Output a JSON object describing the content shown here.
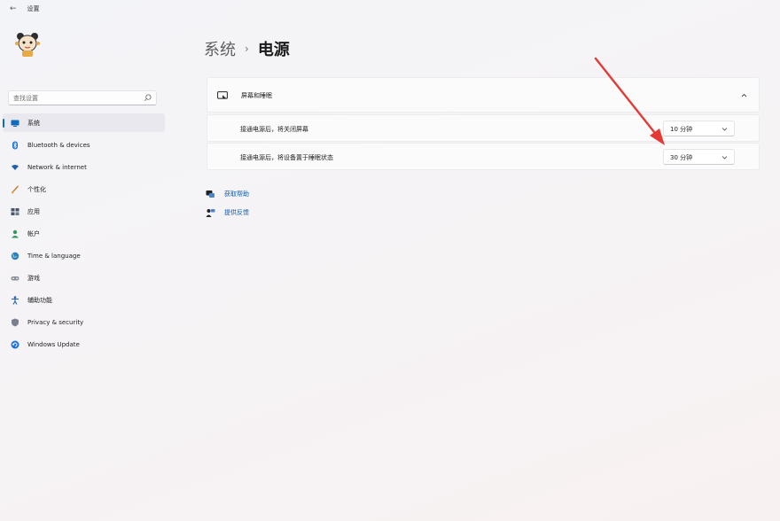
{
  "window": {
    "title": "设置"
  },
  "search": {
    "placeholder": "查找设置"
  },
  "sidebar": {
    "items": [
      {
        "label": "系统",
        "icon": "monitor-icon",
        "active": true
      },
      {
        "label": "Bluetooth & devices",
        "icon": "bluetooth-icon"
      },
      {
        "label": "Network & internet",
        "icon": "wifi-icon"
      },
      {
        "label": "个性化",
        "icon": "brush-icon"
      },
      {
        "label": "应用",
        "icon": "apps-icon"
      },
      {
        "label": "帐户",
        "icon": "person-icon"
      },
      {
        "label": "Time & language",
        "icon": "globe-clock-icon"
      },
      {
        "label": "游戏",
        "icon": "gamepad-icon"
      },
      {
        "label": "辅助功能",
        "icon": "accessibility-icon"
      },
      {
        "label": "Privacy & security",
        "icon": "shield-icon"
      },
      {
        "label": "Windows Update",
        "icon": "update-icon"
      }
    ]
  },
  "header": {
    "parent": "系统",
    "separator": "›",
    "current": "电源"
  },
  "section": {
    "title": "屏幕和睡眠",
    "rows": [
      {
        "label": "接通电源后，将关闭屏幕",
        "value": "10 分钟"
      },
      {
        "label": "接通电源后，将设备置于睡眠状态",
        "value": "30 分钟"
      }
    ]
  },
  "links": [
    {
      "label": "获取帮助",
      "icon": "help-icon"
    },
    {
      "label": "提供反馈",
      "icon": "feedback-icon"
    }
  ],
  "colors": {
    "accent": "#0f6cbd",
    "annotation_arrow": "#e53935",
    "link": "#0f5cab"
  }
}
